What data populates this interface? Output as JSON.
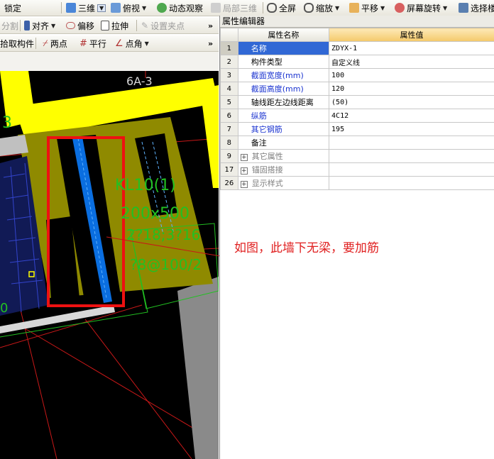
{
  "toolbar1": {
    "lock": "锁定",
    "view3d": "三维",
    "topview": "俯视",
    "dynamic": "动态观察",
    "local3d": "局部三维",
    "fullscreen": "全屏",
    "zoom": "缩放",
    "pan": "平移",
    "rotate": "屏幕旋转",
    "select": "选择楼"
  },
  "toolbar2": {
    "split": "分割",
    "align": "对齐",
    "offset": "偏移",
    "stretch": "拉伸",
    "setgrip": "设置夹点"
  },
  "toolbar3": {
    "pick": "拾取构件",
    "twopoint": "两点",
    "parallel": "平行",
    "pointangle": "点角"
  },
  "canvas": {
    "axis_label": "6A-3",
    "left_label": "3",
    "beam_name": "KL10(1)",
    "beam_size": "200x500",
    "beam_rebar": "2?18;3?16",
    "beam_stirrup": "?8@100/2",
    "left_num": "0"
  },
  "annotation": "如图，此墙下无梁，要加筋",
  "panel": {
    "title": "属性编辑器",
    "col_name": "属性名称",
    "col_value": "属性值",
    "rows": [
      {
        "num": "1",
        "name": "名称",
        "value": "ZDYX-1"
      },
      {
        "num": "2",
        "name": "构件类型",
        "value": "自定义线"
      },
      {
        "num": "3",
        "name": "截面宽度(mm)",
        "value": "100"
      },
      {
        "num": "4",
        "name": "截面高度(mm)",
        "value": "120"
      },
      {
        "num": "5",
        "name": "轴线距左边线距离",
        "value": "(50)"
      },
      {
        "num": "6",
        "name": "纵筋",
        "value": "4C12"
      },
      {
        "num": "7",
        "name": "其它钢筋",
        "value": "195"
      },
      {
        "num": "8",
        "name": "备注",
        "value": ""
      },
      {
        "num": "9",
        "name": "其它属性",
        "value": ""
      },
      {
        "num": "17",
        "name": "锚固搭接",
        "value": ""
      },
      {
        "num": "26",
        "name": "显示样式",
        "value": ""
      }
    ]
  },
  "colors": {
    "accent": "#3168d5",
    "wall_yellow": "#ffff00",
    "wall_olive": "#8f8a00",
    "rebar_text": "#22c022",
    "highlight_red": "#ee1111",
    "bar_blue": "#0a6ee0"
  }
}
